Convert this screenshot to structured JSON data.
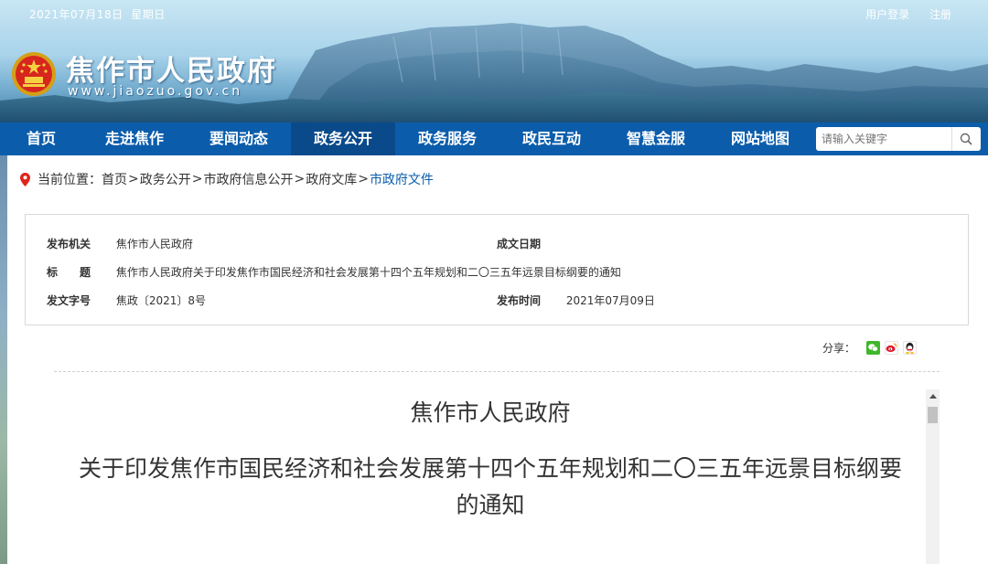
{
  "header": {
    "date": "2021年07月18日",
    "weekday": "星期日",
    "links": {
      "login": "用户登录",
      "register": "注册"
    },
    "site_name": "焦作市人民政府",
    "site_url": "www.jiaozuo.gov.cn"
  },
  "nav": {
    "items": [
      {
        "label": "首页"
      },
      {
        "label": "走进焦作"
      },
      {
        "label": "要闻动态"
      },
      {
        "label": "政务公开"
      },
      {
        "label": "政务服务"
      },
      {
        "label": "政民互动"
      },
      {
        "label": "智慧金服"
      },
      {
        "label": "网站地图"
      }
    ],
    "active_index": 3,
    "search_placeholder": "请输入关键字"
  },
  "breadcrumb": {
    "prefix": "当前位置：",
    "items": [
      "首页",
      "政务公开",
      "市政府信息公开",
      "政府文库",
      "市政府文件"
    ],
    "separator": ">"
  },
  "info": {
    "issuer_label": "发布机关",
    "issuer_value": "焦作市人民政府",
    "date_label": "成文日期",
    "date_value": "",
    "title_label": "标　　题",
    "title_value": "焦作市人民政府关于印发焦作市国民经济和社会发展第十四个五年规划和二〇三五年远景目标纲要的通知",
    "docno_label": "发文字号",
    "docno_value": "焦政〔2021〕8号",
    "pubdate_label": "发布时间",
    "pubdate_value": "2021年07月09日"
  },
  "share": {
    "label": "分享：",
    "icons": [
      "wechat-icon",
      "weibo-icon",
      "qq-icon"
    ]
  },
  "document": {
    "issuer": "焦作市人民政府",
    "title_line1": "关于印发焦作市国民经济和社会发展第十四个五年规划和二〇三五年远景目标纲要",
    "title_line2": "的通知"
  },
  "colors": {
    "nav_bg": "#0b5dab",
    "nav_active": "#0a4a8a",
    "accent_link": "#0b5dab",
    "pin_red": "#e2231a"
  }
}
